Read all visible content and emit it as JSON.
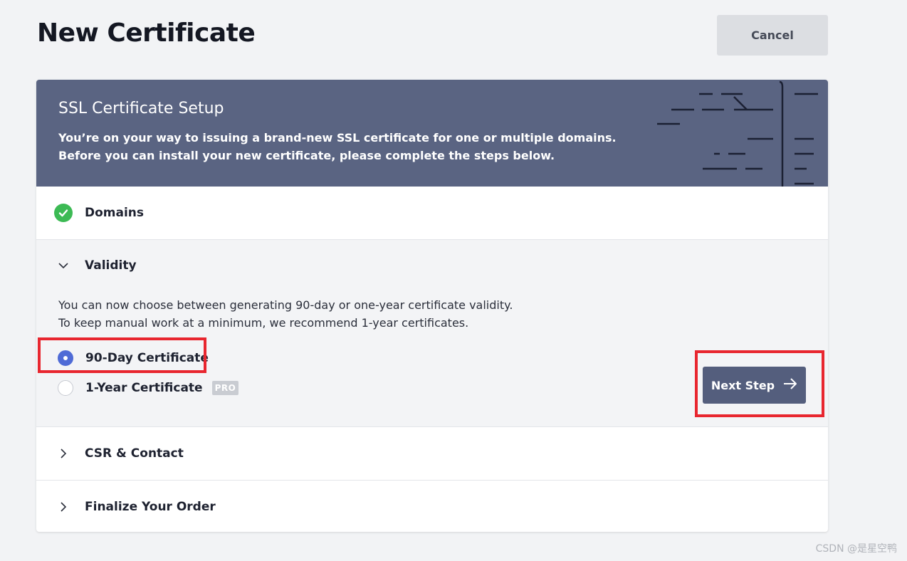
{
  "page": {
    "title": "New Certificate",
    "cancel_label": "Cancel"
  },
  "card": {
    "title": "SSL Certificate Setup",
    "desc_line1": "You’re on your way to issuing a brand-new SSL certificate for one or multiple domains.",
    "desc_line2": "Before you can install your new certificate, please complete the steps below."
  },
  "steps": {
    "domains": {
      "label": "Domains",
      "status": "complete"
    },
    "validity": {
      "label": "Validity",
      "text_line1": "You can now choose between generating 90-day or one-year certificate validity.",
      "text_line2": "To keep manual work at a minimum, we recommend 1-year certificates.",
      "options": [
        {
          "label": "90-Day Certificate",
          "selected": true
        },
        {
          "label": "1-Year Certificate",
          "selected": false,
          "badge": "PRO"
        }
      ],
      "next_label": "Next Step"
    },
    "csr": {
      "label": "CSR & Contact"
    },
    "finalize": {
      "label": "Finalize Your Order"
    }
  },
  "icons": {
    "domains_status": "check-circle-icon",
    "validity_toggle": "chevron-down-icon",
    "csr_toggle": "chevron-right-icon",
    "finalize_toggle": "chevron-right-icon",
    "next": "arrow-right-icon"
  },
  "colors": {
    "header_bg": "#5a6482",
    "accent": "#4f6bd6",
    "success": "#3cba54",
    "highlight": "#e8262f",
    "button_bg": "#545e7d"
  },
  "watermark": "CSDN @是星空鸭"
}
